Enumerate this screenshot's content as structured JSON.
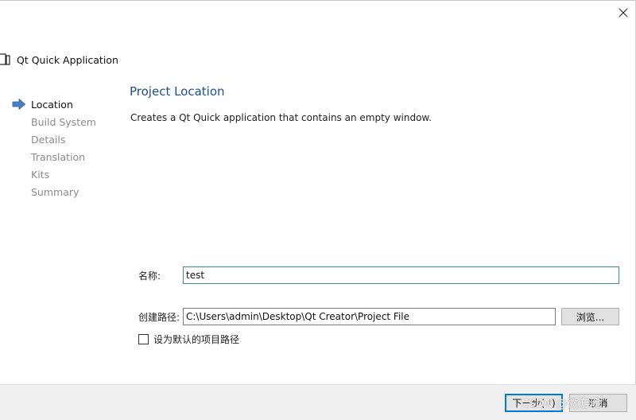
{
  "window": {
    "close_icon": "close-icon"
  },
  "header": {
    "title": "Qt Quick Application",
    "icon": "wizard-page-icon"
  },
  "steps": [
    {
      "label": "Location",
      "active": true
    },
    {
      "label": "Build System",
      "active": false
    },
    {
      "label": "Details",
      "active": false
    },
    {
      "label": "Translation",
      "active": false
    },
    {
      "label": "Kits",
      "active": false
    },
    {
      "label": "Summary",
      "active": false
    }
  ],
  "page": {
    "title": "Project Location",
    "description": "Creates a Qt Quick application that contains an empty window."
  },
  "form": {
    "name_label": "名称:",
    "name_value": "test",
    "path_label": "创建路径:",
    "path_value": "C:\\Users\\admin\\Desktop\\Qt Creator\\Project File",
    "browse_label": "浏览...",
    "default_path_label": "设为默认的项目路径",
    "default_path_checked": false
  },
  "footer": {
    "next_label": "下一步(N)",
    "cancel_label": "取消"
  },
  "watermark": "CSDN @微游魂",
  "colors": {
    "title_blue": "#1d4f8c",
    "arrow_blue": "#4a7fc4",
    "focus_border": "#3f8f7f",
    "default_button_border": "#0078d7"
  }
}
